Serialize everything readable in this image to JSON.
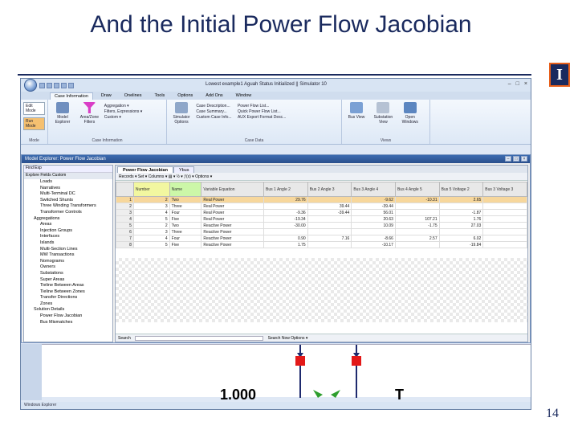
{
  "slide": {
    "title": "And the Initial Power Flow Jacobian",
    "page_number": "14",
    "logo_letter": "I"
  },
  "app": {
    "window_title": "Lowest example1 Aguah Status Initialized || Simulator 10",
    "win_controls": [
      "–",
      "□",
      "×"
    ],
    "ribbon_tabs": [
      "Case Information",
      "Draw",
      "Onelines",
      "Tools",
      "Options",
      "Add Ons",
      "Window"
    ],
    "groups": {
      "mode": {
        "edit": "Edit Mode",
        "run": "Run Mode",
        "label": "Mode"
      },
      "case_info": {
        "buttons": [
          "Model Explorer",
          "Area/Zone Filters"
        ],
        "lines": [
          "Aggregation ▾",
          "Filters, Expressions ▾",
          "Custom ▾"
        ],
        "label": "Case Information"
      },
      "case_data": {
        "buttons": [
          "Simulator Options"
        ],
        "lines": [
          "Case Description...",
          "Case Summary...",
          "Custom Case Info..."
        ],
        "lines2": [
          "Power Flow List...",
          "Quick Power Flow List...",
          "AUX Export Format Desc..."
        ],
        "label": "Case Data"
      },
      "views": {
        "buttons": [
          "Bus View",
          "Substation View",
          "Open Windows"
        ],
        "label": "Views"
      }
    }
  },
  "explorer": {
    "title": "Model Explorer: Power Flow Jacobian",
    "search_label": "Find Exp",
    "tabs_label": "Explore  Fields  Custom",
    "tree": [
      {
        "label": "Loads",
        "indent": 1
      },
      {
        "label": "Narratives",
        "indent": 1
      },
      {
        "label": "Multi-Terminal DC",
        "indent": 1
      },
      {
        "label": "Switched Shunts",
        "indent": 1
      },
      {
        "label": "Three Winding Transformers",
        "indent": 1
      },
      {
        "label": "Transformer Controls",
        "indent": 1
      },
      {
        "label": "Aggregations",
        "indent": 0
      },
      {
        "label": "Areas",
        "indent": 1
      },
      {
        "label": "Injection Groups",
        "indent": 1
      },
      {
        "label": "Interfaces",
        "indent": 1
      },
      {
        "label": "Islands",
        "indent": 1
      },
      {
        "label": "Multi-Section Lines",
        "indent": 1
      },
      {
        "label": "MW Transactions",
        "indent": 1
      },
      {
        "label": "Nomograms",
        "indent": 1
      },
      {
        "label": "Owners",
        "indent": 1
      },
      {
        "label": "Substations",
        "indent": 1
      },
      {
        "label": "Super Areas",
        "indent": 1
      },
      {
        "label": "Tieline Between Areas",
        "indent": 1
      },
      {
        "label": "Tieline Between Zones",
        "indent": 1
      },
      {
        "label": "Transfer Directions",
        "indent": 1
      },
      {
        "label": "Zones",
        "indent": 1
      },
      {
        "label": "Solution Details",
        "indent": 0
      },
      {
        "label": "Power Flow Jacobian",
        "indent": 1
      },
      {
        "label": "Bus Mismatches",
        "indent": 1
      }
    ],
    "tabs": [
      "Power Flow Jacobian",
      "Ybus"
    ],
    "toolbar_text": "Records ▾  Set ▾  Columns ▾  ▤ ▾  ½ ▾  ƒ(x) ▾  Options ▾",
    "columns": [
      "",
      "Number",
      "Name",
      "Variable Equation",
      "Bus 1 Angle 2",
      "Bus 2 Angle 3",
      "Bus 3 Angle 4",
      "Bus 4 Angle 5",
      "Bus 5 Voltage 2",
      "Bus 3 Voltage 3"
    ],
    "rows": [
      [
        "1",
        "2",
        "Two",
        "Real Power",
        "29.76",
        "",
        "-9.62",
        "-10.31",
        "2.65"
      ],
      [
        "2",
        "3",
        "Three",
        "Real Power",
        "",
        "39.44",
        "-39.44",
        "",
        ""
      ],
      [
        "3",
        "4",
        "Four",
        "Real Power",
        "-9.36",
        "-39.44",
        "56.01",
        "",
        "-1.87"
      ],
      [
        "4",
        "5",
        "Five",
        "Real Power",
        "-19.34",
        "",
        "20.63",
        "107.21",
        "1.76"
      ],
      [
        "5",
        "2",
        "Two",
        "Reactive Power",
        "-30.00",
        "",
        "10.09",
        "-1.75",
        "27.03"
      ],
      [
        "6",
        "3",
        "Three",
        "Reactive Power",
        "",
        "",
        "",
        "",
        ""
      ],
      [
        "7",
        "4",
        "Four",
        "Reactive Power",
        "0.90",
        "7.16",
        "-8.66",
        "2.57",
        "6.02"
      ],
      [
        "8",
        "5",
        "Five",
        "Reactive Power",
        "1.75",
        "",
        "-10.17",
        "",
        "-19.84"
      ]
    ],
    "search_text": "Search",
    "search_options": "Search Now  Options ▾"
  },
  "oneline": {
    "text_left": "1.000",
    "text_right": "T"
  },
  "statusbar": "Windows Explorer",
  "colors": {
    "slide_title": "#1a2a5e",
    "logo_border": "#e85f1a",
    "bus_red": "#e31919",
    "flow_green": "#2e9e2e"
  }
}
